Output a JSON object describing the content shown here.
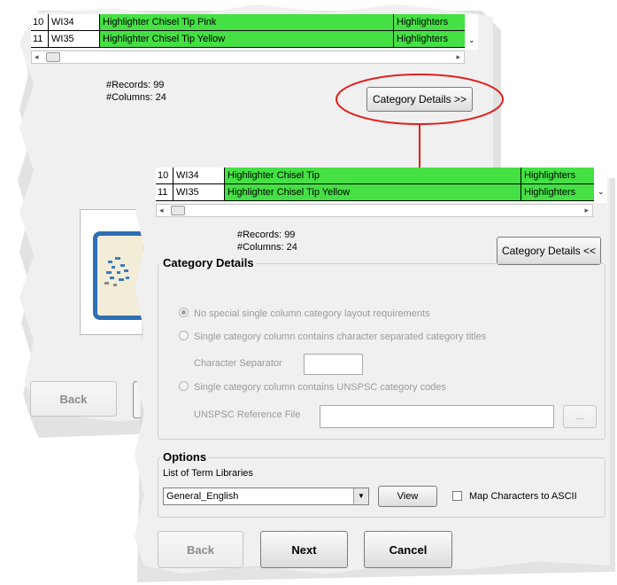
{
  "back_window": {
    "rows": [
      {
        "num": "10",
        "code": "WI34",
        "name": "Highlighter Chisel Tip Pink",
        "category": "Highlighters"
      },
      {
        "num": "11",
        "code": "WI35",
        "name": "Highlighter Chisel Tip Yellow",
        "category": "Highlighters"
      }
    ],
    "records": "#Records: 99",
    "columns": "#Columns: 24",
    "category_details_button": "Category Details >>",
    "back_button": "Back"
  },
  "front_window": {
    "rows": [
      {
        "num": "10",
        "code": "WI34",
        "name": "Highlighter Chisel Tip",
        "category": "Highlighters"
      },
      {
        "num": "11",
        "code": "WI35",
        "name": "Highlighter Chisel Tip Yellow",
        "category": "Highlighters"
      }
    ],
    "records": "#Records: 99",
    "columns": "#Columns: 24",
    "category_details_button": "Category Details <<",
    "category_details": {
      "title": "Category Details",
      "option_none": "No special single column category layout requirements",
      "option_separated": "Single category column contains character separated category titles",
      "separator_label": "Character Separator",
      "separator_value": "",
      "option_unspsc": "Single category column contains UNSPSC category codes",
      "unspsc_label": "UNSPSC Reference File",
      "unspsc_value": "",
      "browse_label": "..."
    },
    "options": {
      "title": "Options",
      "term_libraries_label": "List of Term Libraries",
      "term_library_selected": "General_English",
      "view_button": "View",
      "map_ascii_label": "Map Characters to ASCII",
      "map_ascii_checked": false
    },
    "back_button": "Back",
    "next_button": "Next",
    "cancel_button": "Cancel"
  },
  "colors": {
    "highlight_green": "#44e044",
    "annotation_red": "#e0201c",
    "panel_bg": "#f0f0f0"
  }
}
